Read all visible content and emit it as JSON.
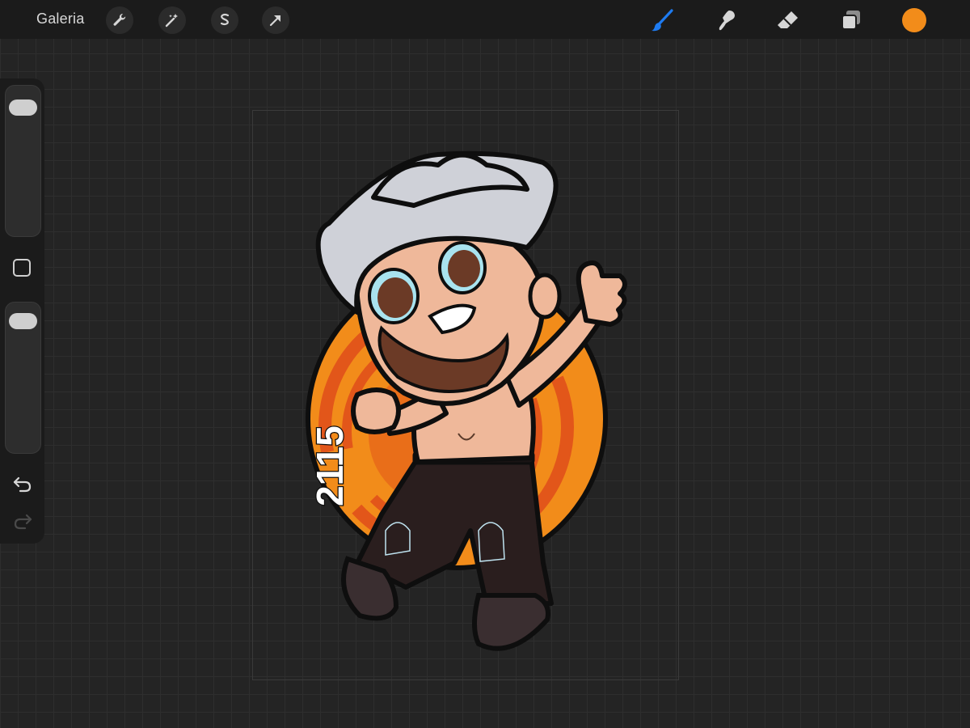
{
  "topbar": {
    "gallery_label": "Galeria",
    "left_tools": [
      {
        "name": "actions-wrench-icon"
      },
      {
        "name": "adjustments-magic-wand-icon"
      },
      {
        "name": "selection-s-icon"
      },
      {
        "name": "transform-arrow-icon"
      }
    ],
    "right_tools": [
      {
        "name": "brush-icon",
        "active": true
      },
      {
        "name": "smudge-icon"
      },
      {
        "name": "eraser-icon"
      },
      {
        "name": "layers-icon"
      }
    ],
    "current_color": "#F28C1A",
    "active_tool_color": "#1E7BF0"
  },
  "sidebar": {
    "brush_size_slider": {
      "level": 0.92
    },
    "opacity_slider": {
      "level": 0.94
    },
    "undo_icon": "undo-icon",
    "redo_icon": "redo-icon"
  },
  "artwork": {
    "badge_text": "2115",
    "colors": {
      "circle_orange": "#F28C1A",
      "circle_dark_orange": "#E2561A",
      "hat": "#CFD1D8",
      "skin": "#EFB89A",
      "beard": "#6B3A26",
      "pants": "#2A1E1E",
      "outline": "#0E0E0E"
    }
  }
}
